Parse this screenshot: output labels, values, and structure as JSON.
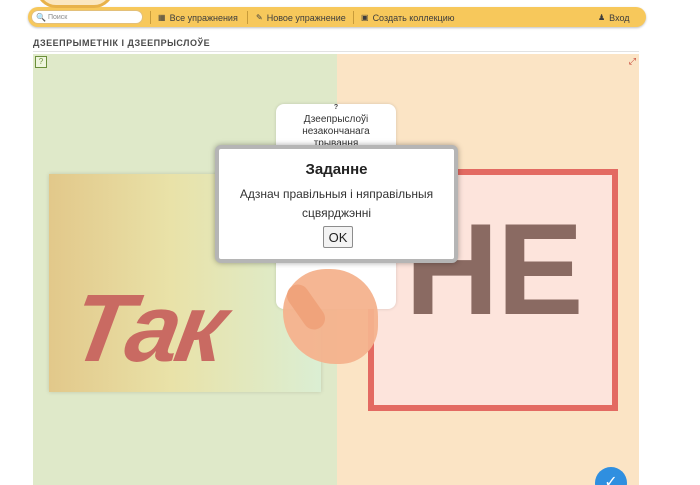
{
  "nav": {
    "search_placeholder": "Поиск",
    "items": [
      {
        "label": "Все упражнения",
        "icon": "grid-icon"
      },
      {
        "label": "Новое упражнение",
        "icon": "pencil-icon"
      },
      {
        "label": "Создать коллекцию",
        "icon": "collection-icon"
      }
    ],
    "login_label": "Вход",
    "login_icon": "user-icon"
  },
  "page": {
    "title": "ДЗЕЕПРЫМЕТНІК І ДЗЕЕПРЫСЛОЎЕ"
  },
  "exercise": {
    "left_label": "Так",
    "right_label": "НЕ",
    "card": {
      "help": "?",
      "text": "Дзеепрыслоўі незакончанага трывання"
    },
    "colors": {
      "left_bg": "#dfe9c9",
      "right_bg": "#fbe4c5",
      "tak_text": "#c96a62",
      "ne_frame": "#e36a62",
      "check_button": "#2f8fe0"
    }
  },
  "modal": {
    "title": "Заданне",
    "body": "Адзнач правільныя і няправільныя сцвярджэнні",
    "ok_label": "OK"
  }
}
